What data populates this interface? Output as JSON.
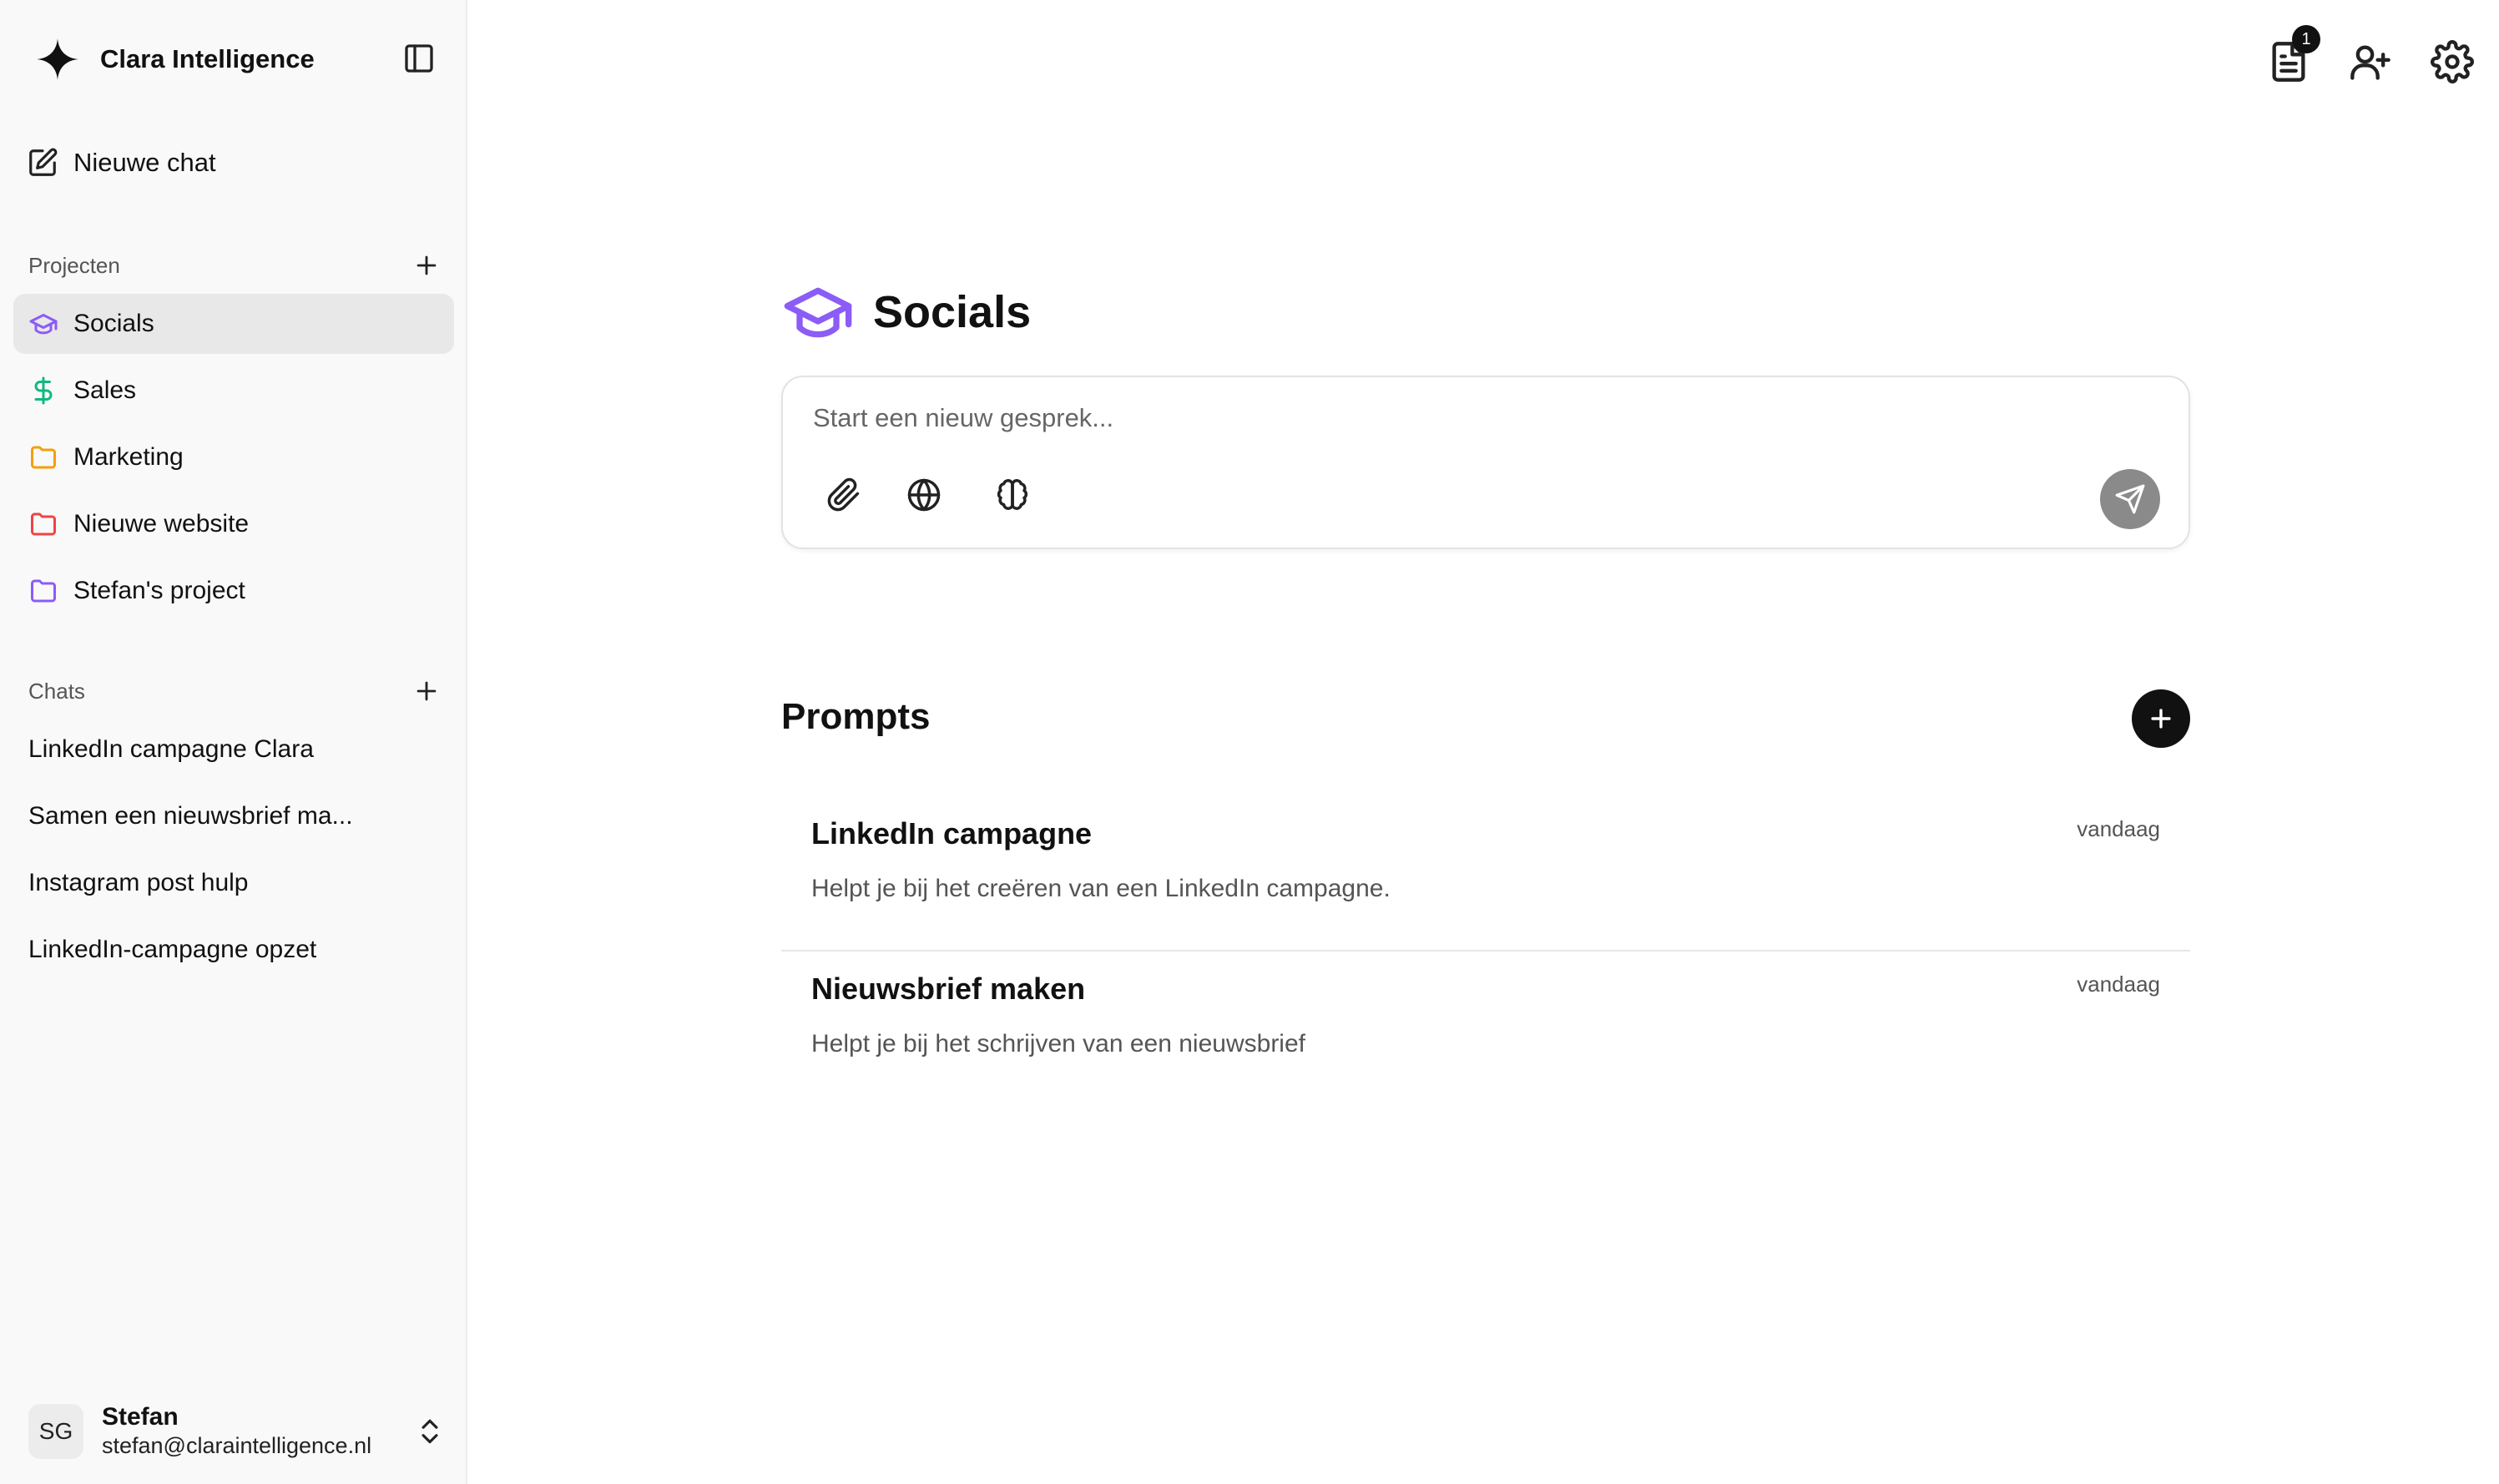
{
  "app": {
    "name": "Clara Intelligence"
  },
  "sidebar": {
    "new_chat_label": "Nieuwe chat",
    "projects_header": "Projecten",
    "projects": [
      {
        "label": "Socials",
        "icon": "graduation-cap-icon",
        "color": "#8b5cf6",
        "active": true
      },
      {
        "label": "Sales",
        "icon": "dollar-icon",
        "color": "#10b981"
      },
      {
        "label": "Marketing",
        "icon": "folder-icon",
        "color": "#f59e0b"
      },
      {
        "label": "Nieuwe website",
        "icon": "folder-icon",
        "color": "#ef4444"
      },
      {
        "label": "Stefan's project",
        "icon": "folder-icon",
        "color": "#8b5cf6"
      }
    ],
    "chats_header": "Chats",
    "chats": [
      "LinkedIn campagne Clara",
      "Samen een nieuwsbrief ma...",
      "Instagram post hulp",
      "LinkedIn-campagne opzet"
    ],
    "user": {
      "initials": "SG",
      "name": "Stefan",
      "email": "stefan@claraintelligence.nl"
    }
  },
  "header": {
    "icons": [
      "document-icon",
      "add-user-icon",
      "settings-icon"
    ],
    "document_badge": "1"
  },
  "main": {
    "project_title": "Socials",
    "composer": {
      "placeholder": "Start een nieuw gesprek..."
    },
    "prompts_title": "Prompts",
    "prompts": [
      {
        "title": "LinkedIn campagne",
        "description": "Helpt je bij het creëren van een LinkedIn campagne.",
        "date": "vandaag"
      },
      {
        "title": "Nieuwsbrief maken",
        "description": "Helpt je bij het schrijven van een nieuwsbrief",
        "date": "vandaag"
      }
    ]
  },
  "colors": {
    "accent": "#8b5cf6",
    "send_button": "#8a8a8a",
    "sidebar_bg": "#f9f9f9"
  }
}
